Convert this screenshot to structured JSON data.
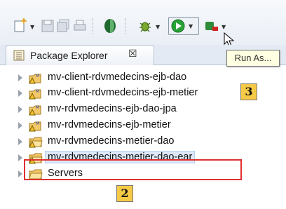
{
  "toolbar": {
    "items": [
      "new-icon",
      "save-icon",
      "save-all-icon",
      "print-icon",
      "eclipse-toggle-icon",
      "debug-icon",
      "run-icon",
      "external-tools-icon"
    ],
    "dropdown_glyph": "▼"
  },
  "tooltip": {
    "text": "Run As..."
  },
  "view_tab": {
    "title": "Package Explorer",
    "close": "☒"
  },
  "tree": {
    "items": [
      {
        "label": "mv-client-rdvmedecins-ejb-dao",
        "icon": "java-project-warning-icon",
        "selected": false
      },
      {
        "label": "mv-client-rdvmedecins-ejb-metier",
        "icon": "java-project-warning-icon",
        "selected": false
      },
      {
        "label": "mv-rdvmedecins-ejb-dao-jpa",
        "icon": "java-project-warning-icon",
        "selected": false
      },
      {
        "label": "mv-rdvmedecins-ejb-metier",
        "icon": "java-project-warning-icon",
        "selected": false
      },
      {
        "label": "mv-rdvmedecins-metier-dao",
        "icon": "folder-warning-icon",
        "selected": false
      },
      {
        "label": "mv-rdvmedecins-metier-dao-ear",
        "icon": "folder-warning-icon",
        "selected": true
      },
      {
        "label": "Servers",
        "icon": "folder-icon",
        "selected": false
      }
    ]
  },
  "annotations": {
    "badge_3": "3",
    "badge_2": "2",
    "highlight_color": "#e03030",
    "badge_color": "#f6ca46"
  }
}
